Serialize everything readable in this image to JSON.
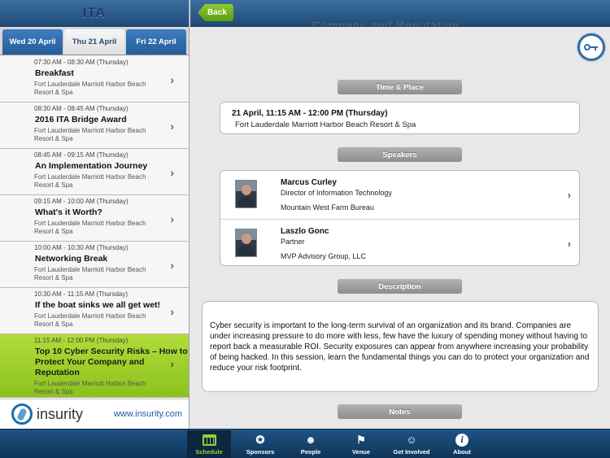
{
  "left": {
    "logo": "ITA",
    "tabs": [
      {
        "label": "Wed 20 April"
      },
      {
        "label": "Thu 21 April"
      },
      {
        "label": "Fri 22 April"
      }
    ],
    "sessions": [
      {
        "time": "07:30 AM - 08:30 AM (Thursday)",
        "title": "Breakfast",
        "location": "Fort Lauderdale Marriott Harbor Beach Resort & Spa"
      },
      {
        "time": "08:30 AM - 08:45 AM (Thursday)",
        "title": "2016 ITA Bridge Award",
        "location": "Fort Lauderdale Marriott Harbor Beach Resort & Spa"
      },
      {
        "time": "08:45 AM - 09:15 AM (Thursday)",
        "title": "An Implementation Journey",
        "location": "Fort Lauderdale Marriott Harbor Beach Resort & Spa"
      },
      {
        "time": "09:15 AM - 10:00 AM (Thursday)",
        "title": "What's it Worth?",
        "location": "Fort Lauderdale Marriott Harbor Beach Resort & Spa"
      },
      {
        "time": "10:00 AM - 10:30 AM (Thursday)",
        "title": "Networking Break",
        "location": "Fort Lauderdale Marriott Harbor Beach Resort & Spa"
      },
      {
        "time": "10:30 AM - 11:15 AM (Thursday)",
        "title": "If the boat sinks we all get wet!",
        "location": "Fort Lauderdale Marriott Harbor Beach Resort & Spa"
      },
      {
        "time": "11:15 AM - 12:00 PM (Thursday)",
        "title": "Top 10 Cyber Security Risks – How to Protect Your Company and Reputation",
        "location": "Fort Lauderdale Marriott Harbor Beach Resort & Spa"
      }
    ],
    "sponsor": {
      "name": "insurity",
      "url": "www.insurity.com"
    }
  },
  "header": {
    "back_label": "Back",
    "ghost_title": "Company and Reputation"
  },
  "detail": {
    "time_place_label": "Time & Place",
    "date_line": "21 April, 11:15 AM - 12:00 PM (Thursday)",
    "location": "Fort Lauderdale Marriott Harbor Beach Resort & Spa",
    "speakers_label": "Speakers",
    "speakers": [
      {
        "name": "Marcus Curley",
        "role": "Director of Information Technology",
        "org": "Mountain West Farm Bureau"
      },
      {
        "name": "Laszlo Gonc",
        "role": "Partner",
        "org": "MVP Advisory Group, LLC"
      }
    ],
    "description_label": "Description",
    "description": "Cyber security is important to the long-term survival of an organization and its brand. Companies are under increasing pressure to do more with less, few have the luxury of spending money without having to report back a measurable ROI. Security exposures can appear from anywhere increasing your probability of being hacked. In this session, learn the fundamental things you can do to protect your organization and reduce your risk footprint.",
    "notes_label": "Notes"
  },
  "tabbar": [
    {
      "label": "Schedule",
      "icon": "calendar-icon"
    },
    {
      "label": "Sponsors",
      "icon": "award-icon"
    },
    {
      "label": "People",
      "icon": "people-icon"
    },
    {
      "label": "Venue",
      "icon": "venue-flag-icon"
    },
    {
      "label": "Get Involved",
      "icon": "handshake-icon"
    },
    {
      "label": "About",
      "icon": "info-icon"
    }
  ],
  "colors": {
    "accent_green": "#8cc21d",
    "header_blue": "#1f4a78"
  }
}
